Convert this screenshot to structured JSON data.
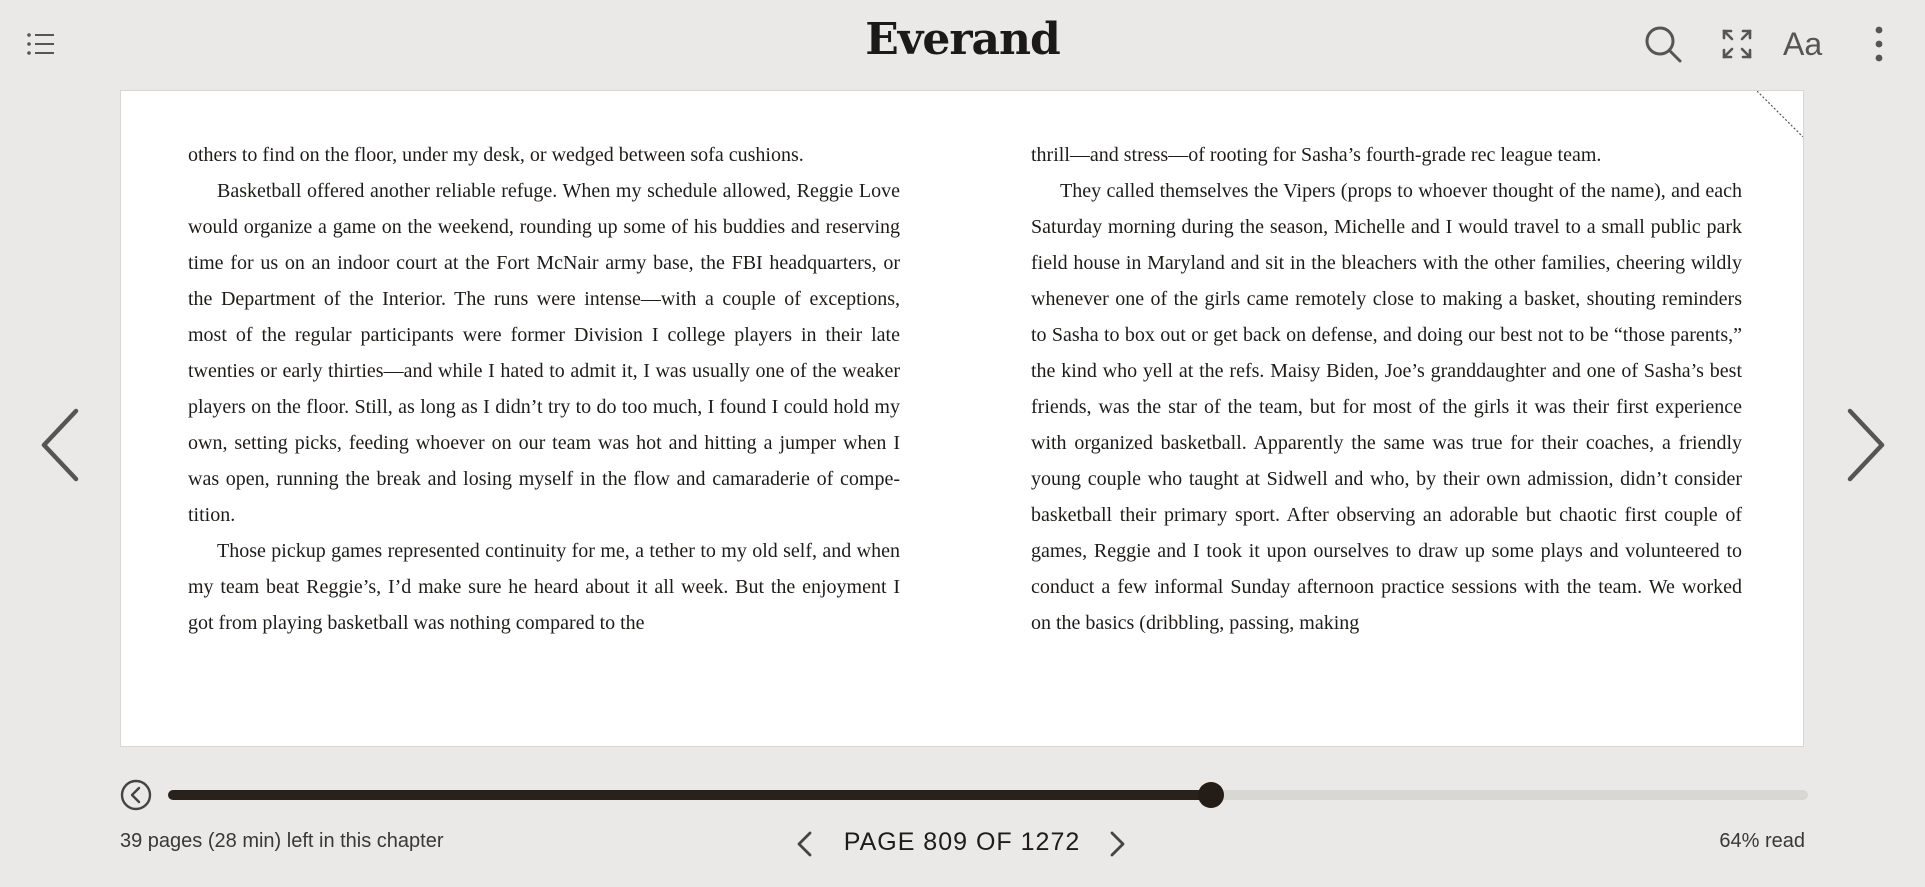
{
  "app": {
    "brand": "Everand"
  },
  "toolbar": {
    "toc_icon": "list-icon",
    "search_icon": "search-icon",
    "fullscreen_icon": "expand-icon",
    "font_settings_label": "Aa",
    "more_icon": "more-vertical-icon"
  },
  "page_left": {
    "paragraphs": [
      {
        "indent": false,
        "text": "others to find on the floor, under my desk, or wedged between sofa cushions."
      },
      {
        "indent": true,
        "text": "Basketball offered another reliable refuge. When my schedule allowed, Reg­gie Love would organize a game on the weekend, rounding up some of his buddies and reserving time for us on an indoor court at the Fort McNair army base, the FBI headquarters, or the Department of the Interior. The runs were in­tense—with a couple of exceptions, most of the regular participants were for­mer Division I college players in their late twenties or early thirties—and while I hated to admit it, I was usually one of the weaker players on the floor. Still, as long as I didn’t try to do too much, I found I could hold my own, setting picks, feeding whoever on our team was hot and hitting a jumper when I was open, running the break and losing myself in the flow and camaraderie of compe­tition."
      },
      {
        "indent": true,
        "text": "Those pickup games represented continuity for me, a tether to my old self, and when my team beat Reggie’s, I’d make sure he heard about it all week. But the enjoyment I got from playing basketball was nothing compared to the"
      }
    ]
  },
  "page_right": {
    "paragraphs": [
      {
        "indent": false,
        "text": "thrill—and stress—of rooting for Sasha’s fourth-grade rec league team."
      },
      {
        "indent": true,
        "text": "They called themselves the Vipers (props to whoever thought of the name), and each Saturday morning during the season, Michelle and I would travel to a small public park field house in Maryland and sit in the bleachers with the other families, cheering wildly whenever one of the girls came remotely close to making a basket, shouting reminders to Sasha to box out or get back on de­fense, and doing our best not to be “those parents,” the kind who yell at the refs. Maisy Biden, Joe’s granddaughter and one of Sasha’s best friends, was the star of the team, but for most of the girls it was their first experience with orga­nized basketball. Apparently the same was true for their coaches, a friendly young couple who taught at Sidwell and who, by their own admission, didn’t consider basketball their primary sport. After observing an adorable but chaotic first couple of games, Reggie and I took it upon ourselves to draw up some plays and volunteered to conduct a few informal Sunday afternoon practice sessions with the team. We worked on the basics (dribbling, passing, making"
      }
    ]
  },
  "navigation": {
    "prev_icon": "chevron-left-icon",
    "next_icon": "chevron-right-icon"
  },
  "progress": {
    "rewind_icon": "back-circle-icon",
    "fraction": 0.636,
    "chapter_remaining": "39 pages (28 min) left in this chapter",
    "page_label": "PAGE 809 OF 1272",
    "percent_read": "64% read"
  }
}
